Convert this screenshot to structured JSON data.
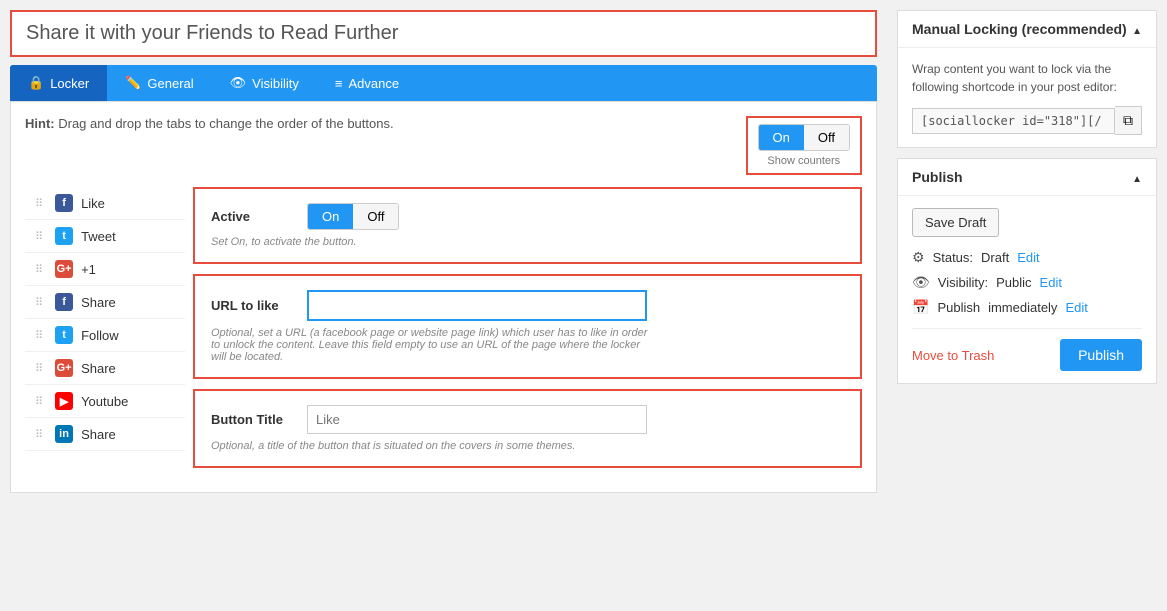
{
  "title": {
    "text": "Share it with your Friends to Read Further"
  },
  "tabs": [
    {
      "id": "locker",
      "label": "Locker",
      "icon": "🔒",
      "active": true
    },
    {
      "id": "general",
      "label": "General",
      "icon": "✏️",
      "active": false
    },
    {
      "id": "visibility",
      "label": "Visibility",
      "icon": "👁",
      "active": false
    },
    {
      "id": "advance",
      "label": "Advance",
      "icon": "≡",
      "active": false
    }
  ],
  "hint": {
    "text": "Hint: Drag and drop the tabs to change the order of the buttons."
  },
  "show_counters": {
    "label": "Show counters",
    "on_label": "On",
    "off_label": "Off",
    "active": "on"
  },
  "social_buttons": [
    {
      "id": "like",
      "icon": "f",
      "icon_class": "icon-fb",
      "label": "Like"
    },
    {
      "id": "tweet",
      "icon": "t",
      "icon_class": "icon-tw",
      "label": "Tweet"
    },
    {
      "id": "plus1",
      "icon": "g+",
      "icon_class": "icon-gp",
      "label": "+1"
    },
    {
      "id": "share_fb",
      "icon": "f",
      "icon_class": "icon-fs",
      "label": "Share"
    },
    {
      "id": "follow",
      "icon": "t",
      "icon_class": "icon-tws",
      "label": "Follow"
    },
    {
      "id": "share_gp",
      "icon": "G+",
      "icon_class": "icon-gps",
      "label": "Share"
    },
    {
      "id": "youtube",
      "icon": "▶",
      "icon_class": "icon-yt",
      "label": "Youtube"
    },
    {
      "id": "share_li",
      "icon": "in",
      "icon_class": "icon-li",
      "label": "Share"
    }
  ],
  "active_section": {
    "label": "Active",
    "on_label": "On",
    "off_label": "Off",
    "active": "on",
    "description": "Set On, to activate the button."
  },
  "url_section": {
    "label": "URL to like",
    "value": "",
    "placeholder": "",
    "description": "Optional, set a URL (a facebook page or website page link) which user has to like in order to unlock the content. Leave this field empty to use an URL of the page where the locker will be located."
  },
  "button_title_section": {
    "label": "Button Title",
    "value": "",
    "placeholder": "Like",
    "description": "Optional, a title of the button that is situated on the covers in some themes."
  },
  "manual_locking": {
    "title": "Manual Locking (recommended)",
    "description": "Wrap content you want to lock via the following shortcode in your post editor:",
    "shortcode": "[sociallocker id=\"318\"][/"
  },
  "publish_box": {
    "title": "Publish",
    "save_draft_label": "Save Draft",
    "status_label": "Status:",
    "status_value": "Draft",
    "status_edit": "Edit",
    "visibility_label": "Visibility:",
    "visibility_value": "Public",
    "visibility_edit": "Edit",
    "publish_label": "Publish",
    "publish_value": "immediately",
    "publish_edit": "Edit",
    "move_trash_label": "Move to Trash",
    "publish_btn_label": "Publish"
  }
}
